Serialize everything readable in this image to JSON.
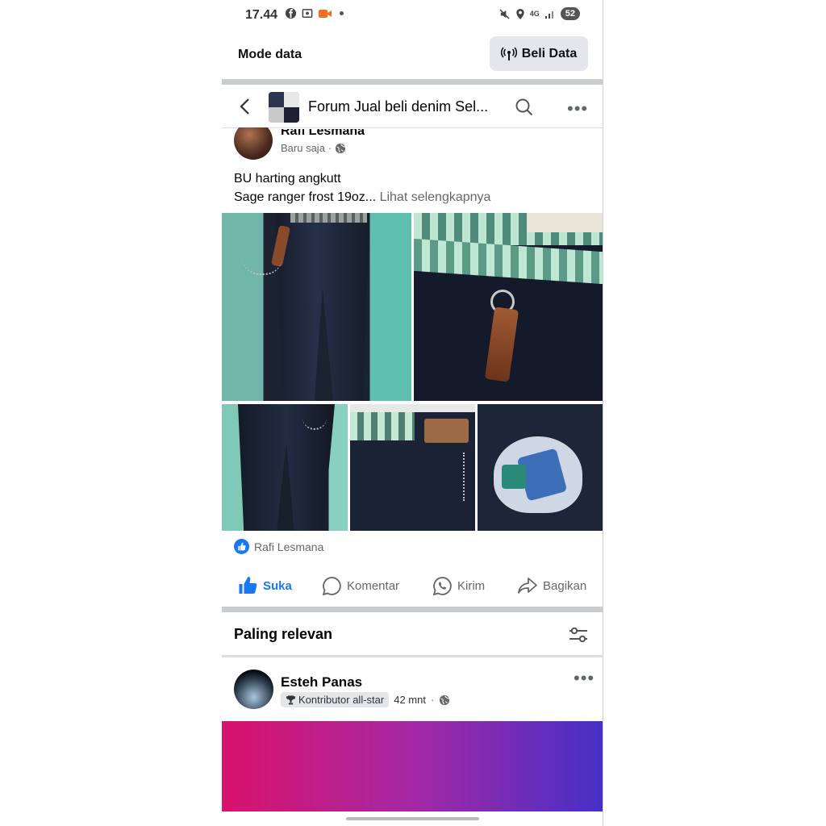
{
  "status_bar": {
    "time": "17.44",
    "network": "4G",
    "battery": "52"
  },
  "data_bar": {
    "mode_label": "Mode data",
    "buy_label": "Beli Data"
  },
  "header": {
    "group_title": "Forum Jual beli denim Sel..."
  },
  "post": {
    "author": "Rafi Lesmana",
    "time": "Baru saja",
    "line1": "BU harting angkutt",
    "line2": "Sage ranger frost 19oz...",
    "see_more": "Lihat selengkapnya",
    "reaction_name": "Rafi Lesmana"
  },
  "actions": {
    "like": "Suka",
    "comment": "Komentar",
    "send": "Kirim",
    "share": "Bagikan"
  },
  "comments_section": {
    "sort_label": "Paling relevan"
  },
  "next_post": {
    "author": "Esteh Panas",
    "badge": "Kontributor all-star",
    "time": "42 mnt"
  },
  "colors": {
    "brand_blue": "#1877f2",
    "separator": "#c9ccd1"
  }
}
